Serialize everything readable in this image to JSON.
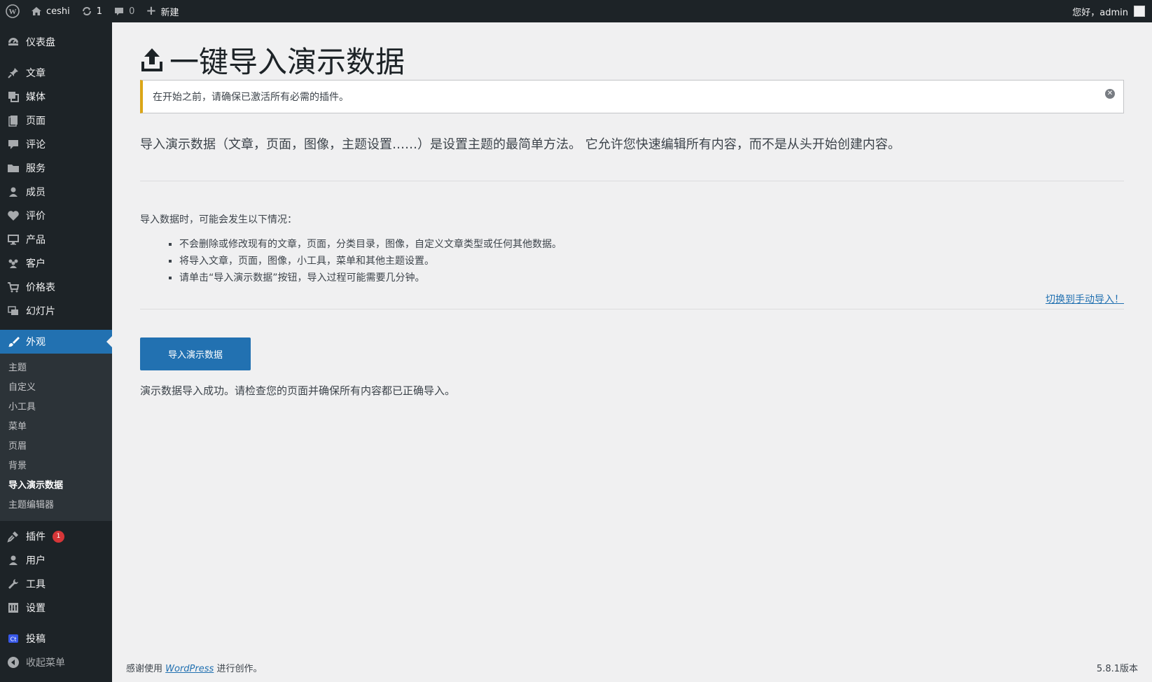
{
  "adminbar": {
    "site_name": "ceshi",
    "updates_count": "1",
    "comments_count": "0",
    "new_label": "新建",
    "greeting": "您好，admin"
  },
  "sidebar": {
    "items": [
      {
        "label": "仪表盘",
        "icon": "dashboard-icon"
      },
      {
        "label": "文章",
        "icon": "pin-icon"
      },
      {
        "label": "媒体",
        "icon": "media-icon"
      },
      {
        "label": "页面",
        "icon": "page-icon"
      },
      {
        "label": "评论",
        "icon": "comment-icon"
      },
      {
        "label": "服务",
        "icon": "folder-icon"
      },
      {
        "label": "成员",
        "icon": "person-icon"
      },
      {
        "label": "评价",
        "icon": "heart-icon"
      },
      {
        "label": "产品",
        "icon": "desktop-icon"
      },
      {
        "label": "客户",
        "icon": "groups-icon"
      },
      {
        "label": "价格表",
        "icon": "cart-icon"
      },
      {
        "label": "幻灯片",
        "icon": "slides-icon"
      },
      {
        "label": "外观",
        "icon": "brush-icon"
      },
      {
        "label": "插件",
        "icon": "plugin-icon",
        "badge": "1"
      },
      {
        "label": "用户",
        "icon": "users-icon"
      },
      {
        "label": "工具",
        "icon": "wrench-icon"
      },
      {
        "label": "设置",
        "icon": "settings-icon"
      },
      {
        "label": "投稿",
        "icon": "ct-icon"
      },
      {
        "label": "收起菜单",
        "icon": "collapse-icon"
      }
    ],
    "submenu": [
      "主题",
      "自定义",
      "小工具",
      "菜单",
      "页眉",
      "背景",
      "导入演示数据",
      "主题编辑器"
    ]
  },
  "main": {
    "title": "一键导入演示数据",
    "notice": "在开始之前，请确保已激活所有必需的插件。",
    "intro": "导入演示数据（文章，页面，图像，主题设置……）是设置主题的最简单方法。 它允许您快速编辑所有内容，而不是从头开始创建内容。",
    "situations_title": "导入数据时，可能会发生以下情况：",
    "situations": [
      "不会删除或修改现有的文章，页面，分类目录，图像，自定义文章类型或任何其他数据。",
      "将导入文章，页面，图像，小工具，菜单和其他主题设置。",
      "请单击“导入演示数据”按钮，导入过程可能需要几分钟。"
    ],
    "manual_link": "切换到手动导入！",
    "import_button": "导入演示数据",
    "success": "演示数据导入成功。请检查您的页面并确保所有内容都已正确导入。"
  },
  "footer": {
    "thanks_prefix": "感谢使用",
    "wp_link": "WordPress",
    "thanks_suffix": "进行创作。",
    "version": "5.8.1版本"
  },
  "colors": {
    "accent": "#2271b1",
    "adminbar_bg": "#1d2327",
    "notice_warning": "#dba617",
    "badge": "#d63638"
  }
}
